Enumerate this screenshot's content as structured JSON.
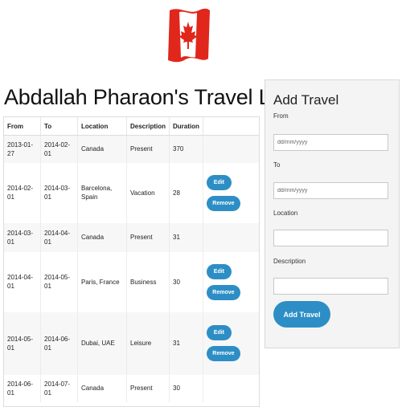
{
  "page": {
    "title": "Abdallah Pharaon's Travel Log",
    "flag_icon": "canada-flag-icon",
    "accent_color": "#2d8ec5"
  },
  "table": {
    "headers": [
      "From",
      "To",
      "Location",
      "Description",
      "Duration",
      ""
    ],
    "rows": [
      {
        "from": "2013-01-27",
        "to": "2014-02-01",
        "location": "Canada",
        "description": "Present",
        "duration": "370",
        "editable": false
      },
      {
        "from": "2014-02-01",
        "to": "2014-03-01",
        "location": "Barcelona, Spain",
        "description": "Vacation",
        "duration": "28",
        "editable": true
      },
      {
        "from": "2014-03-01",
        "to": "2014-04-01",
        "location": "Canada",
        "description": "Present",
        "duration": "31",
        "editable": false
      },
      {
        "from": "2014-04-01",
        "to": "2014-05-01",
        "location": "Paris, France",
        "description": "Business",
        "duration": "30",
        "editable": true
      },
      {
        "from": "2014-05-01",
        "to": "2014-06-01",
        "location": "Dubai, UAE",
        "description": "Leisure",
        "duration": "31",
        "editable": true
      },
      {
        "from": "2014-06-01",
        "to": "2014-07-01",
        "location": "Canada",
        "description": "Present",
        "duration": "30",
        "editable": false
      }
    ],
    "edit_label": "Edit",
    "remove_label": "Remove"
  },
  "form": {
    "heading": "Add Travel",
    "from_label": "From",
    "from_placeholder": "dd/mm/yyyy",
    "to_label": "To",
    "to_placeholder": "dd/mm/yyyy",
    "location_label": "Location",
    "location_value": "",
    "description_label": "Description",
    "description_value": "",
    "submit_label": "Add Travel"
  }
}
